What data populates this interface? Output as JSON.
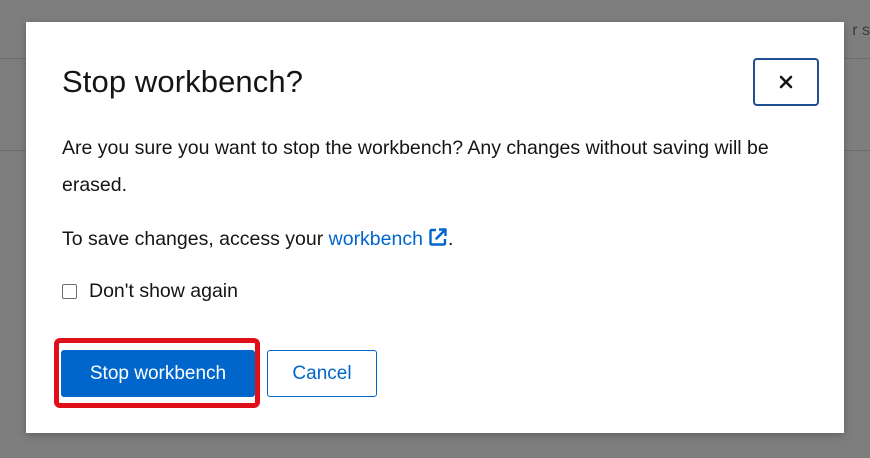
{
  "background": {
    "fragment_text": "r s"
  },
  "modal": {
    "title": "Stop workbench?",
    "close_icon": "close-icon",
    "message": "Are you sure you want to stop the workbench? Any changes without saving will be erased.",
    "access_prefix": "To save changes, access your ",
    "access_link": "workbench",
    "access_suffix": ".",
    "link_icon": "external-link-icon",
    "checkbox_label": "Don't show again",
    "checkbox_checked": false,
    "primary_button": "Stop workbench",
    "secondary_button": "Cancel"
  },
  "colors": {
    "primary": "#0066cc",
    "highlight": "#e0101a",
    "text": "#151515"
  }
}
